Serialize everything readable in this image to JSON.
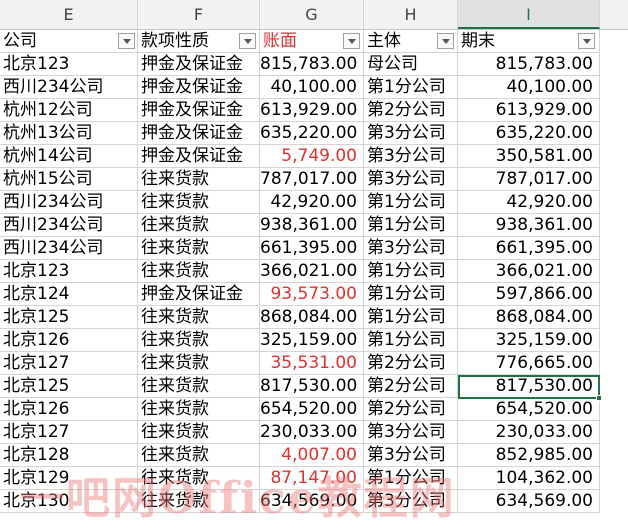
{
  "columns": [
    "E",
    "F",
    "G",
    "H",
    "I"
  ],
  "header": {
    "company": "公司",
    "type": "款项性质",
    "book": "账面",
    "entity": "主体",
    "ending": "期末"
  },
  "rows": [
    {
      "company": "北京123",
      "type": "押金及保证金",
      "book": "815,783.00",
      "entity": "母公司",
      "ending": "815,783.00"
    },
    {
      "company": "西川234公司",
      "type": "押金及保证金",
      "book": "40,100.00",
      "entity": "第1分公司",
      "ending": "40,100.00"
    },
    {
      "company": "杭州12公司",
      "type": "押金及保证金",
      "book": "613,929.00",
      "entity": "第2分公司",
      "ending": "613,929.00"
    },
    {
      "company": "杭州13公司",
      "type": "押金及保证金",
      "book": "635,220.00",
      "entity": "第3分公司",
      "ending": "635,220.00"
    },
    {
      "company": "杭州14公司",
      "type": "押金及保证金",
      "book": "5,749.00",
      "entity": "第3分公司",
      "ending": "350,581.00",
      "red": true
    },
    {
      "company": "杭州15公司",
      "type": "往来货款",
      "book": "787,017.00",
      "entity": "第3分公司",
      "ending": "787,017.00"
    },
    {
      "company": "西川234公司",
      "type": "往来货款",
      "book": "42,920.00",
      "entity": "第1分公司",
      "ending": "42,920.00"
    },
    {
      "company": "西川234公司",
      "type": "往来货款",
      "book": "938,361.00",
      "entity": "第1分公司",
      "ending": "938,361.00"
    },
    {
      "company": "西川234公司",
      "type": "往来货款",
      "book": "661,395.00",
      "entity": "第3分公司",
      "ending": "661,395.00"
    },
    {
      "company": "北京123",
      "type": "往来货款",
      "book": "366,021.00",
      "entity": "第1分公司",
      "ending": "366,021.00"
    },
    {
      "company": "北京124",
      "type": "押金及保证金",
      "book": "93,573.00",
      "entity": "第1分公司",
      "ending": "597,866.00",
      "red": true
    },
    {
      "company": "北京125",
      "type": "往来货款",
      "book": "868,084.00",
      "entity": "第1分公司",
      "ending": "868,084.00"
    },
    {
      "company": "北京126",
      "type": "往来货款",
      "book": "325,159.00",
      "entity": "第1分公司",
      "ending": "325,159.00"
    },
    {
      "company": "北京127",
      "type": "往来货款",
      "book": "35,531.00",
      "entity": "第2分公司",
      "ending": "776,665.00",
      "red": true
    },
    {
      "company": "北京125",
      "type": "往来货款",
      "book": "817,530.00",
      "entity": "第2分公司",
      "ending": "817,530.00"
    },
    {
      "company": "北京126",
      "type": "往来货款",
      "book": "654,520.00",
      "entity": "第2分公司",
      "ending": "654,520.00"
    },
    {
      "company": "北京127",
      "type": "往来货款",
      "book": "230,033.00",
      "entity": "第3分公司",
      "ending": "230,033.00"
    },
    {
      "company": "北京128",
      "type": "往来货款",
      "book": "4,007.00",
      "entity": "第3分公司",
      "ending": "852,985.00",
      "red": true
    },
    {
      "company": "北京129",
      "type": "往来货款",
      "book": "87,147.00",
      "entity": "第1分公司",
      "ending": "104,362.00",
      "red": true
    },
    {
      "company": "北京130",
      "type": "往来货款",
      "book": "634,569.00",
      "entity": "第3分公司",
      "ending": "634,569.00"
    }
  ],
  "active_cell": "I15",
  "watermark": "一吧网Office教程网",
  "colors": {
    "accent": "#217346",
    "red_text": "#e03030"
  },
  "icons": {
    "filter": "dropdown-arrow-icon"
  }
}
